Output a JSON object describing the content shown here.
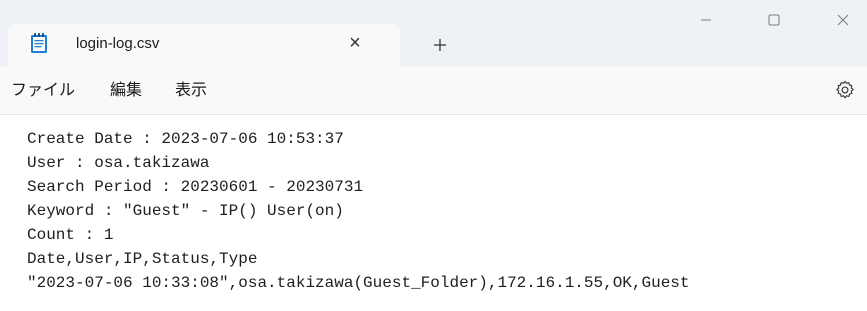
{
  "tab": {
    "title": "login-log.csv",
    "close_glyph": "×",
    "new_tab_icon": "plus-icon",
    "app_icon": "notepad-icon"
  },
  "window_controls": {
    "minimize_icon": "minimize-icon",
    "maximize_icon": "maximize-icon",
    "close_icon": "close-icon"
  },
  "menu": {
    "items": [
      "ファイル",
      "編集",
      "表示"
    ],
    "settings_icon": "gear-icon"
  },
  "editor": {
    "lines": [
      "Create Date : 2023-07-06 10:53:37",
      "User : osa.takizawa",
      "Search Period : 20230601 - 20230731",
      "Keyword : \"Guest\" - IP() User(on)",
      "Count : 1",
      "Date,User,IP,Status,Type",
      "\"2023-07-06 10:33:08\",osa.takizawa(Guest_Folder),172.16.1.55,OK,Guest"
    ]
  },
  "colors": {
    "titlebar_bg": "#eef1f6",
    "tab_bg": "#f9f9fa",
    "icon_blue": "#1e7fd4",
    "text": "#1e1e1e"
  }
}
